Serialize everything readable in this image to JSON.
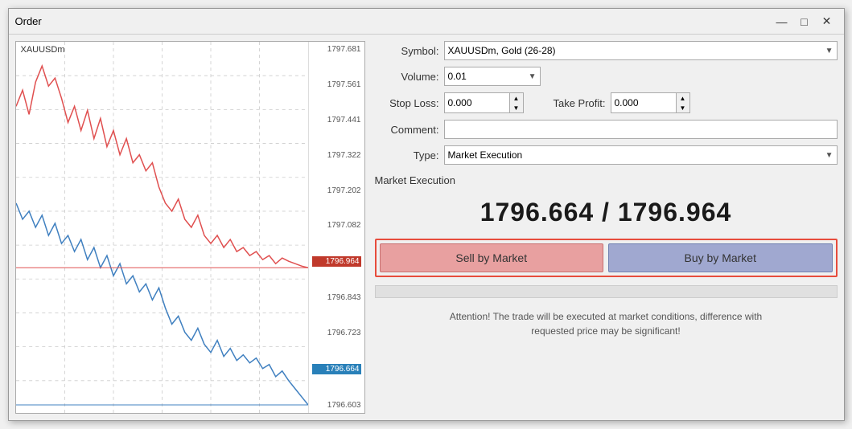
{
  "window": {
    "title": "Order",
    "min_btn": "—",
    "max_btn": "□",
    "close_btn": "✕"
  },
  "chart": {
    "symbol_label": "XAUUSDm",
    "price_levels": [
      "1797.681",
      "1797.561",
      "1797.441",
      "1797.322",
      "1797.202",
      "1797.082",
      "1796.964",
      "1796.843",
      "1796.723",
      "1796.664",
      "1796.603"
    ],
    "red_price": "1796.964",
    "blue_price": "1796.664"
  },
  "form": {
    "symbol_label": "Symbol:",
    "symbol_value": "XAUUSDm, Gold (26-28)",
    "volume_label": "Volume:",
    "volume_value": "0.01",
    "stop_loss_label": "Stop Loss:",
    "stop_loss_value": "0.000",
    "take_profit_label": "Take Profit:",
    "take_profit_value": "0.000",
    "comment_label": "Comment:",
    "comment_value": "",
    "type_label": "Type:",
    "type_value": "Market Execution"
  },
  "order": {
    "execution_label": "Market Execution",
    "bid_price": "1796.664",
    "ask_price": "1796.964",
    "price_separator": " / ",
    "sell_label": "Sell by Market",
    "buy_label": "Buy by Market",
    "attention_text": "Attention! The trade will be executed at market conditions, difference with\nrequested price may be significant!"
  }
}
